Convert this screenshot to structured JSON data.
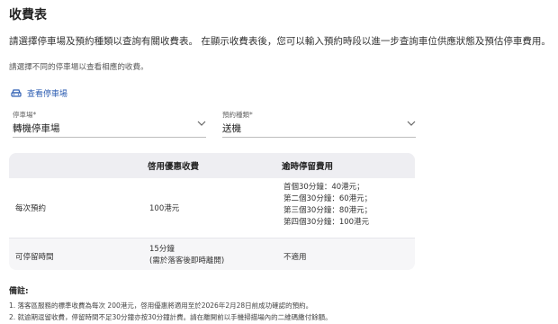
{
  "page": {
    "title": "收費表",
    "intro": "請選擇停車場及預約種類以查詢有關收費表。 在顯示收費表後，您可以輸入預約時段以進一步查詢車位供應狀態及預估停車費用。",
    "subtitle": "請選擇不同的停車場以查看相應的收費。",
    "view_link": "查看停車場"
  },
  "filters": {
    "carpark": {
      "label": "停車場*",
      "value": "轉機停車場"
    },
    "booking_type": {
      "label": "預約種類*",
      "value": "送機"
    }
  },
  "table": {
    "headers": [
      "",
      "啓用優惠收費",
      "逾時停留費用"
    ],
    "rows": [
      {
        "name": "每次預約",
        "discount": "100港元",
        "overtime": [
          "首個30分鐘：40港元；",
          "第二個30分鐘：60港元；",
          "第三個30分鐘：80港元；",
          "第四個30分鐘：100港元"
        ]
      },
      {
        "name": "可停留時間",
        "discount": [
          "15分鐘",
          "(需於落客後即時離開)"
        ],
        "overtime": "不適用"
      }
    ]
  },
  "notes": {
    "title": "備註:",
    "items": [
      "1. 落客區服務的標準收費為每次 200港元，啓用優惠將適用至於2026年2月28日前成功確認的預約。",
      "2. 就逾期逗留收費，停留時間不足30分鐘亦按30分鐘計費。請在離開前以手機掃描場內的二維碼繳付餘額。"
    ]
  },
  "colors": {
    "link": "#2f5fb3",
    "table_bg": "#f6f6f8"
  }
}
